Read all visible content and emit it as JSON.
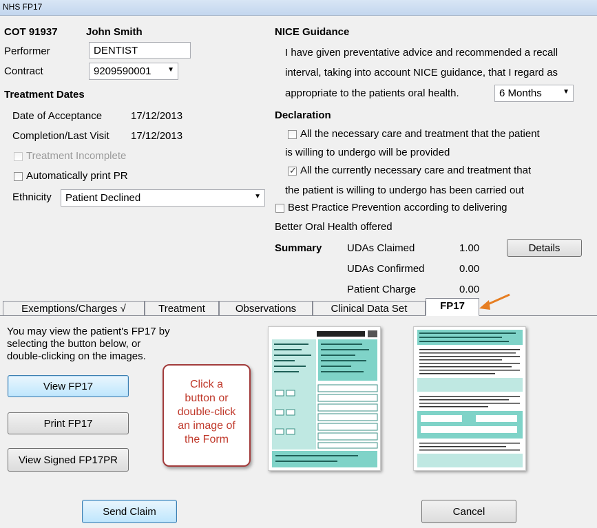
{
  "window": {
    "title": "NHS FP17"
  },
  "header": {
    "cot": "COT 91937",
    "patient_name": "John Smith"
  },
  "performer": {
    "label": "Performer",
    "value": "DENTIST"
  },
  "contract": {
    "label": "Contract",
    "value": "9209590001"
  },
  "treatment_dates": {
    "heading": "Treatment Dates",
    "acceptance_label": "Date of Acceptance",
    "acceptance_value": "17/12/2013",
    "completion_label": "Completion/Last Visit",
    "completion_value": "17/12/2013",
    "incomplete_label": "Treatment Incomplete",
    "auto_print_label": "Automatically print PR",
    "ethnicity_label": "Ethnicity",
    "ethnicity_value": "Patient Declined"
  },
  "nice": {
    "heading": "NICE Guidance",
    "line1": "I have given preventative advice and recommended a recall",
    "line2": "interval, taking into account NICE guidance, that I regard as",
    "line3": "appropriate to the patients oral health.",
    "recall_value": "6 Months"
  },
  "declaration": {
    "heading": "Declaration",
    "item1_line1": "All the necessary care and treatment that the patient",
    "item1_line2": "is willing to undergo will be provided",
    "item2_line1": "All the currently necessary care and treatment that",
    "item2_line2": "the patient is willing to undergo has been carried out",
    "item3_line1": "Best Practice Prevention according to delivering",
    "item3_line2": "Better Oral Health offered",
    "item1_checked": false,
    "item2_checked": true,
    "item3_checked": false
  },
  "summary": {
    "heading": "Summary",
    "udas_claimed_label": "UDAs Claimed",
    "udas_claimed_value": "1.00",
    "udas_confirmed_label": "UDAs Confirmed",
    "udas_confirmed_value": "0.00",
    "patient_charge_label": "Patient Charge",
    "patient_charge_value": "0.00",
    "details_button": "Details"
  },
  "tabs": [
    "Exemptions/Charges  √",
    "Treatment",
    "Observations",
    "Clinical Data Set",
    "FP17"
  ],
  "fp17_panel": {
    "info_line1": "You may view the patient's FP17 by",
    "info_line2": "selecting the button below, or",
    "info_line3": "double-clicking on the images.",
    "view_button": "View FP17",
    "print_button": "Print FP17",
    "view_signed_button": "View Signed FP17PR",
    "callout_line1": "Click a",
    "callout_line2": "button or",
    "callout_line3": "double-click",
    "callout_line4": "an image of",
    "callout_line5": "the Form"
  },
  "footer": {
    "send_button": "Send Claim",
    "cancel_button": "Cancel"
  },
  "colors": {
    "accent_arrow": "#e67e22",
    "callout_border": "#a23b3b",
    "callout_text": "#c0392b",
    "form_teal": "#7fd3c8"
  }
}
